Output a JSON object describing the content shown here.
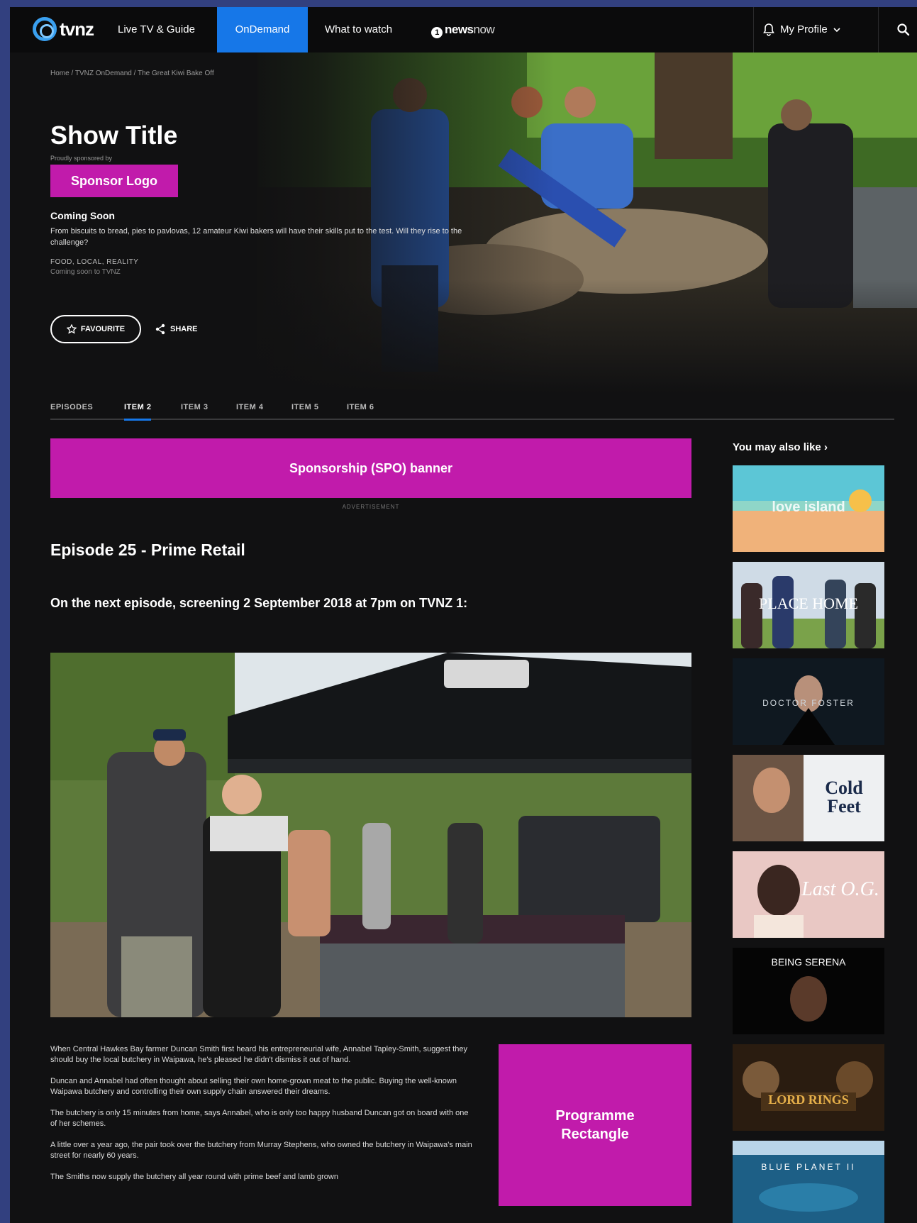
{
  "nav": {
    "logo": "tvnz",
    "items": [
      "Live TV & Guide",
      "OnDemand",
      "What to watch"
    ],
    "newsnow": {
      "bold": "news",
      "light": "now",
      "dot": "1"
    },
    "profile": "My Profile"
  },
  "hero": {
    "breadcrumb": "Home / TVNZ OnDemand / The Great Kiwi Bake Off",
    "title": "Show Title",
    "sponsored_by": "Proudly sponsored by",
    "sponsor_logo": "Sponsor Logo",
    "status": "Coming Soon",
    "description": "From biscuits to bread, pies to pavlovas, 12 amateur Kiwi bakers will have their skills put to the test. Will they rise to the challenge?",
    "genres": "FOOD, LOCAL, REALITY",
    "availability": "Coming soon to TVNZ",
    "favourite": "FAVOURITE",
    "share": "SHARE"
  },
  "tabs": [
    "EPISODES",
    "ITEM 2",
    "ITEM 3",
    "ITEM 4",
    "ITEM 5",
    "ITEM 6"
  ],
  "main": {
    "spo_banner": "Sponsorship (SPO) banner",
    "ad_label": "ADVERTISEMENT",
    "episode_title": "Episode 25 - Prime Retail",
    "next_episode": "On the next episode, screening 2 September 2018 at 7pm on TVNZ 1:",
    "paragraphs": [
      "When Central Hawkes Bay farmer Duncan Smith first heard his entrepreneurial wife, Annabel Tapley-Smith, suggest they should buy the local butchery in Waipawa, he's pleased he didn't dismiss it out of hand.",
      "Duncan and Annabel had often thought about selling their own home-grown meat to the public. Buying the well-known Waipawa butchery and controlling their own supply chain answered their dreams.",
      "The butchery is only 15 minutes from home, says Annabel, who is only too happy husband Duncan got on board with one of her schemes.",
      "A little over a year ago, the pair took over the butchery from Murray Stephens, who owned the butchery in Waipawa's main street for nearly 60 years.",
      "The Smiths now supply the butchery all year round with prime beef and lamb grown"
    ],
    "programme_rectangle": "Programme Rectangle"
  },
  "sidebar": {
    "heading": "You may also like",
    "chevron": "›",
    "thumbs": [
      {
        "text": "love island"
      },
      {
        "text": "PLACE HOME"
      },
      {
        "text": "DOCTOR FOSTER"
      },
      {
        "text": "Cold Feet"
      },
      {
        "text": "Last O.G."
      },
      {
        "text": "BEING SERENA"
      },
      {
        "text": "LORD RINGS"
      },
      {
        "text": "BLUE PLANET II"
      }
    ]
  },
  "colors": {
    "accent_blue": "#1677e8",
    "sponsor_magenta": "#c11bab",
    "page_bg": "#111112"
  }
}
